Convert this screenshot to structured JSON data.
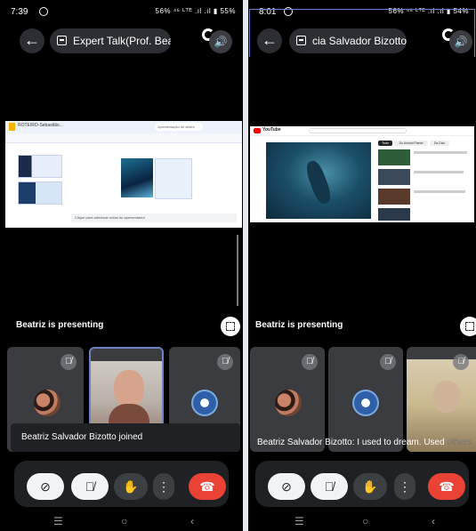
{
  "left": {
    "status": {
      "time": "7:39",
      "right": "56% ⁴⁶ ᴸᵀᴱ .ıl .ıl ▮ 55%"
    },
    "meeting_title": "Expert Talk(Prof. Bea",
    "presenting_label": "Beatriz is presenting",
    "toast": "Beatriz Salvador Bizotto joined",
    "shared_screen": {
      "doc_title": "ROTEIRO-Sebastião...",
      "search_placeholder": "Apresentação de slides",
      "notes_hint": "Clique para adicionar notas do apresentador"
    }
  },
  "right": {
    "status": {
      "time": "8:01",
      "right": "56% ⁴⁶ ᴸᵀᴱ .ıl .ıl ▮ 54%"
    },
    "meeting_title": "cia Salvador Bizotto",
    "presenting_label": "Beatriz is presenting",
    "caption": {
      "text": "Beatriz Salvador Bizotto: I used to dream. Used",
      "faded": "others"
    },
    "shared_screen": {
      "site": "YouTube",
      "chips": [
        "Tudo",
        "Do Animal Planet",
        "Da Disc"
      ]
    }
  },
  "icons": {
    "back": "←",
    "speaker": "🔊",
    "mic_off": "🎙̸",
    "camera_off": "⊘",
    "mic_off_btn": "🎙̸",
    "hand": "✋",
    "more": "⋮",
    "end_call": "☎",
    "nav_recents": "☰",
    "nav_home": "○",
    "nav_back": "‹"
  },
  "colors": {
    "end_call": "#ea4335",
    "active_tile_border": "#6c82c4"
  }
}
